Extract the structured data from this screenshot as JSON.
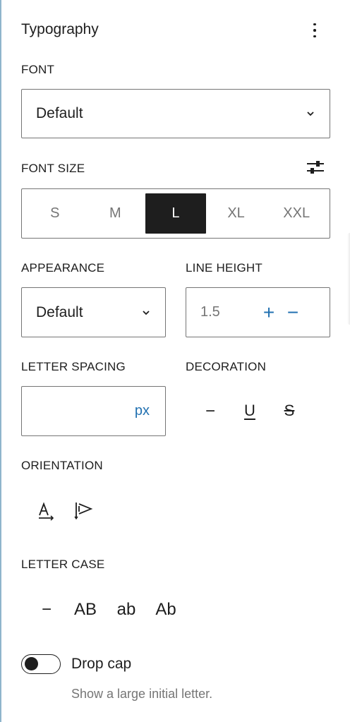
{
  "panel": {
    "title": "Typography"
  },
  "font": {
    "label": "FONT",
    "value": "Default"
  },
  "font_size": {
    "label": "FONT SIZE",
    "options": [
      "S",
      "M",
      "L",
      "XL",
      "XXL"
    ],
    "selected": "L"
  },
  "appearance": {
    "label": "APPEARANCE",
    "value": "Default"
  },
  "line_height": {
    "label": "LINE HEIGHT",
    "value": "1.5",
    "increment": "+",
    "decrement": "−"
  },
  "letter_spacing": {
    "label": "LETTER SPACING",
    "value": "",
    "unit": "px"
  },
  "decoration": {
    "label": "DECORATION",
    "none": "−",
    "underline": "U",
    "strikethrough": "S"
  },
  "orientation": {
    "label": "ORIENTATION"
  },
  "letter_case": {
    "label": "LETTER CASE",
    "options": [
      "−",
      "AB",
      "ab",
      "Ab"
    ]
  },
  "drop_cap": {
    "label": "Drop cap",
    "help": "Show a large initial letter.",
    "enabled": false
  },
  "colors": {
    "accent": "#2271b1",
    "text": "#1e1e1e",
    "muted": "#757575",
    "border": "#757575"
  }
}
